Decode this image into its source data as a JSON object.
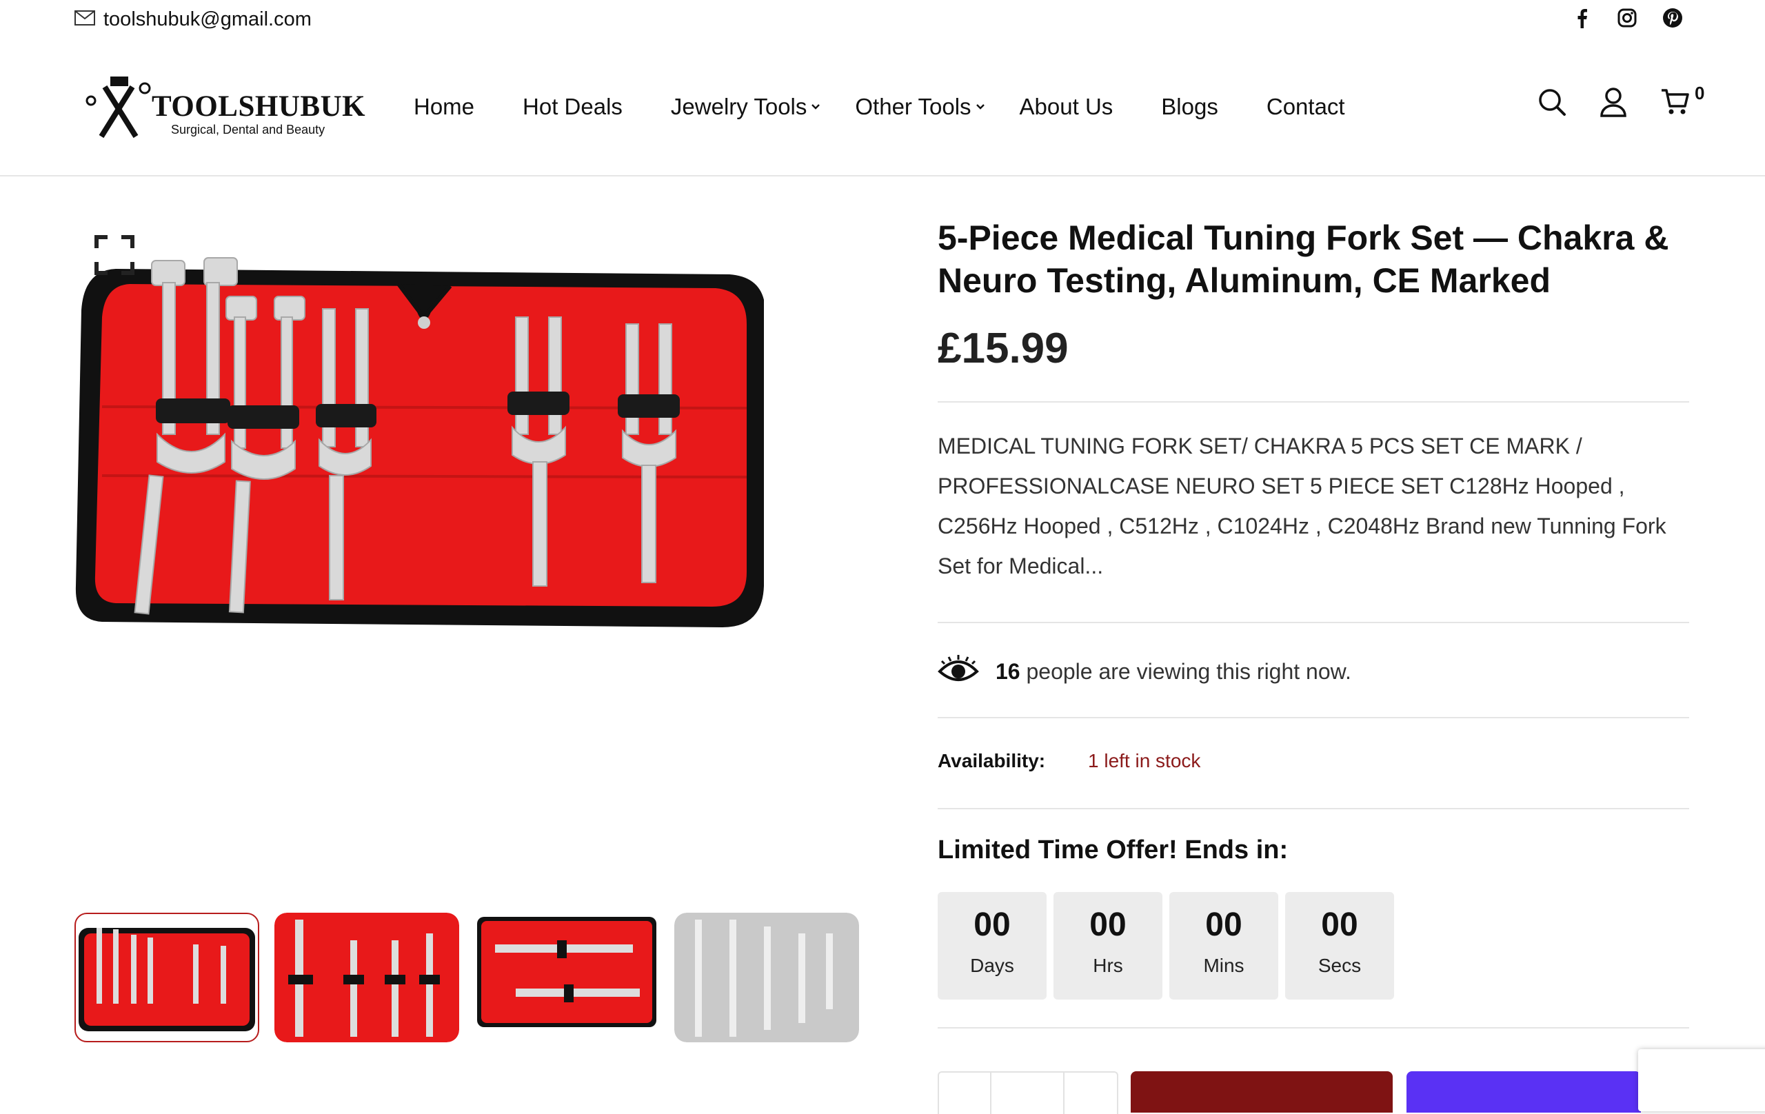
{
  "topbar": {
    "email": "toolshubuk@gmail.com",
    "social_icons": [
      "facebook-icon",
      "instagram-icon",
      "pinterest-icon"
    ]
  },
  "header": {
    "logo_brand": "TOOLSHUBUK",
    "logo_tagline": "Surgical, Dental and Beauty",
    "nav": [
      {
        "label": "Home"
      },
      {
        "label": "Hot Deals"
      },
      {
        "label": "Jewelry Tools",
        "dropdown": true
      },
      {
        "label": "Other Tools",
        "dropdown": true
      },
      {
        "label": "About Us"
      },
      {
        "label": "Blogs"
      },
      {
        "label": "Contact"
      }
    ],
    "cart_count": "0",
    "icons": [
      "search-icon",
      "account-icon",
      "cart-icon"
    ]
  },
  "product": {
    "title": "5-Piece Medical Tuning Fork Set — Chakra & Neuro Testing, Aluminum, CE Marked",
    "price": "£15.99",
    "description": "MEDICAL TUNING FORK SET/ CHAKRA 5 PCS SET CE MARK / PROFESSIONALCASE NEURO SET 5 PIECE SET C128Hz Hooped , C256Hz Hooped , C512Hz , C1024Hz , C2048Hz Brand new Tunning Fork Set for Medical...",
    "viewing_count": "16",
    "viewing_text": "people are viewing this right now.",
    "availability_label": "Availability:",
    "availability_value": "1 left in stock",
    "offer_title": "Limited Time Offer! Ends in:",
    "countdown": [
      {
        "value": "00",
        "unit": "Days"
      },
      {
        "value": "00",
        "unit": "Hrs"
      },
      {
        "value": "00",
        "unit": "Mins"
      },
      {
        "value": "00",
        "unit": "Secs"
      }
    ]
  },
  "colors": {
    "accent_red": "#7f1313",
    "stock_red": "#8b1a1a",
    "buy_now": "#5a31f4",
    "case_red": "#e8191a"
  }
}
